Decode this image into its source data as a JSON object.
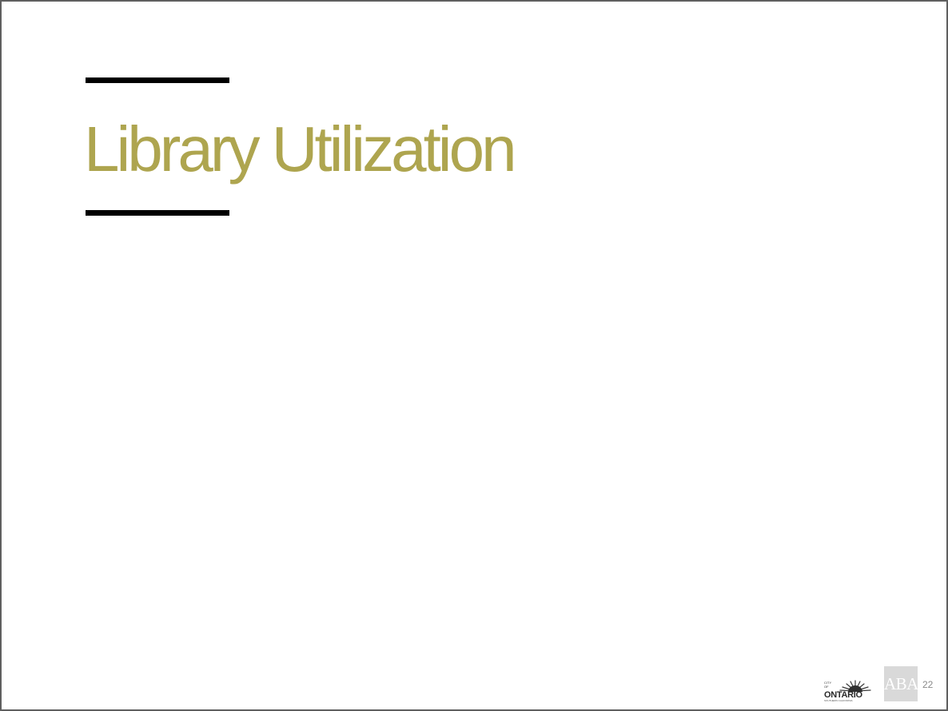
{
  "slide": {
    "title": "Library Utilization",
    "page_number": "22"
  },
  "logos": {
    "ontario": {
      "top_text": "CITY OF",
      "name": "ONTARIO",
      "bottom_text": "SOUTHERN CALIFORNIA"
    },
    "aba": {
      "text": "ABA"
    }
  },
  "colors": {
    "title": "#aea54f",
    "rules": "#000000",
    "border": "#5f5f5f",
    "aba_background": "#d9d9d9"
  }
}
